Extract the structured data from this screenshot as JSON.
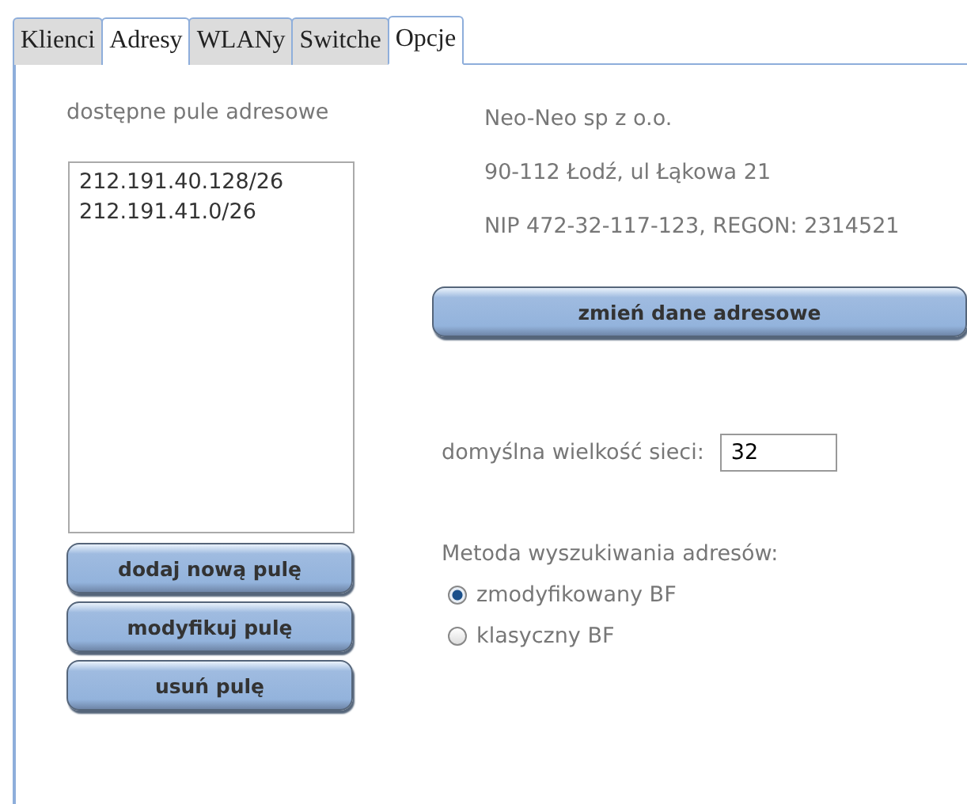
{
  "tabs": [
    {
      "label": "Klienci",
      "selected": false,
      "hovered": false
    },
    {
      "label": "Adresy",
      "selected": false,
      "hovered": true
    },
    {
      "label": "WLANy",
      "selected": false,
      "hovered": false
    },
    {
      "label": "Switche",
      "selected": false,
      "hovered": false
    },
    {
      "label": "Opcje",
      "selected": true,
      "hovered": false
    }
  ],
  "pools": {
    "label": "dostępne pule adresowe",
    "items": [
      "212.191.40.128/26",
      "212.191.41.0/26"
    ],
    "buttons": [
      "dodaj nową pulę",
      "modyfikuj pulę",
      "usuń pulę"
    ]
  },
  "company": {
    "lines": [
      "Neo-Neo sp z o.o.",
      "90-112 Łodź, ul Łąkowa 21",
      "NIP 472-32-117-123, REGON: 2314521"
    ],
    "button": "zmień dane adresowe"
  },
  "network_size": {
    "label": "domyślna wielkość sieci:",
    "value": "32"
  },
  "search_method": {
    "label": "Metoda wyszukiwania adresów:",
    "options": [
      {
        "label": "zmodyfikowany BF",
        "selected": true
      },
      {
        "label": "klasyczny BF",
        "selected": false
      }
    ]
  }
}
